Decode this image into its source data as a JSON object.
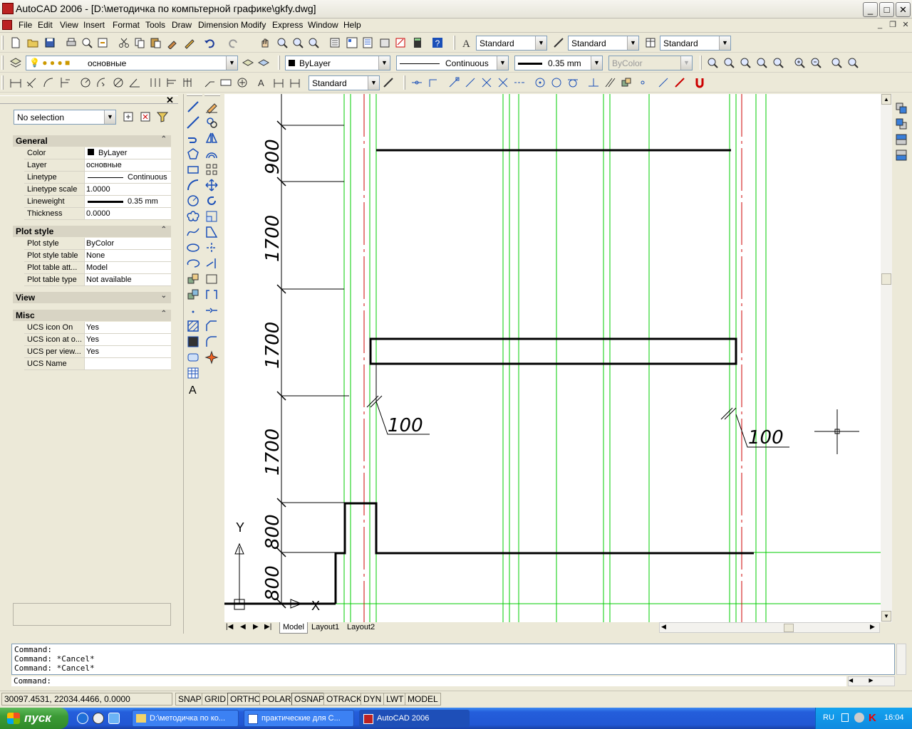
{
  "window": {
    "title": "AutoCAD 2006 - [D:\\методичка по компьтерной графике\\gkfy.dwg]"
  },
  "menu": [
    "File",
    "Edit",
    "View",
    "Insert",
    "Format",
    "Tools",
    "Draw",
    "Dimension",
    "Modify",
    "Express",
    "Window",
    "Help"
  ],
  "toolbar": {
    "text_style": "Standard",
    "dim_style": "Standard",
    "table_style": "Standard",
    "layer": "основные",
    "color": "ByLayer",
    "linetype": "Continuous",
    "lineweight": "0.35 mm",
    "plotstyle": "ByColor",
    "dim_style2": "Standard"
  },
  "properties": {
    "selection": "No selection",
    "sections": {
      "general": "General",
      "plot_style": "Plot style",
      "view": "View",
      "misc": "Misc"
    },
    "general_rows": [
      {
        "k": "Color",
        "v": "ByLayer"
      },
      {
        "k": "Layer",
        "v": "основные"
      },
      {
        "k": "Linetype",
        "v": "Continuous"
      },
      {
        "k": "Linetype scale",
        "v": "1.0000"
      },
      {
        "k": "Lineweight",
        "v": "0.35 mm"
      },
      {
        "k": "Thickness",
        "v": "0.0000"
      }
    ],
    "plot_rows": [
      {
        "k": "Plot style",
        "v": "ByColor"
      },
      {
        "k": "Plot style table",
        "v": "None"
      },
      {
        "k": "Plot table att...",
        "v": "Model"
      },
      {
        "k": "Plot table type",
        "v": "Not available"
      }
    ],
    "misc_rows": [
      {
        "k": "UCS icon On",
        "v": "Yes"
      },
      {
        "k": "UCS icon at o...",
        "v": "Yes"
      },
      {
        "k": "UCS per view...",
        "v": "Yes"
      },
      {
        "k": "UCS Name",
        "v": ""
      }
    ]
  },
  "drawing": {
    "dims": [
      "900",
      "1700",
      "1700",
      "1700",
      "800",
      "800"
    ],
    "labels": [
      "100",
      "100"
    ],
    "ucs": {
      "y": "Y",
      "x": "X"
    }
  },
  "layout_tabs": [
    "Model",
    "Layout1",
    "Layout2"
  ],
  "command": {
    "history": [
      "Command:",
      "Command: *Cancel*",
      "Command: *Cancel*"
    ],
    "prompt": "Command:"
  },
  "status": {
    "coords": "30097.4531, 22034.4466, 0.0000",
    "toggles": [
      "SNAP",
      "GRID",
      "ORTHO",
      "POLAR",
      "OSNAP",
      "OTRACK",
      "DYN",
      "LWT",
      "MODEL"
    ]
  },
  "taskbar": {
    "start": "пуск",
    "tasks": [
      "D:\\методичка по ко...",
      "практические для С...",
      "AutoCAD 2006"
    ],
    "lang": "RU",
    "time": "16:04"
  },
  "colors": {
    "grid": "#00cc00",
    "center": "#cc0000",
    "titlebar": "#ece9d8"
  }
}
